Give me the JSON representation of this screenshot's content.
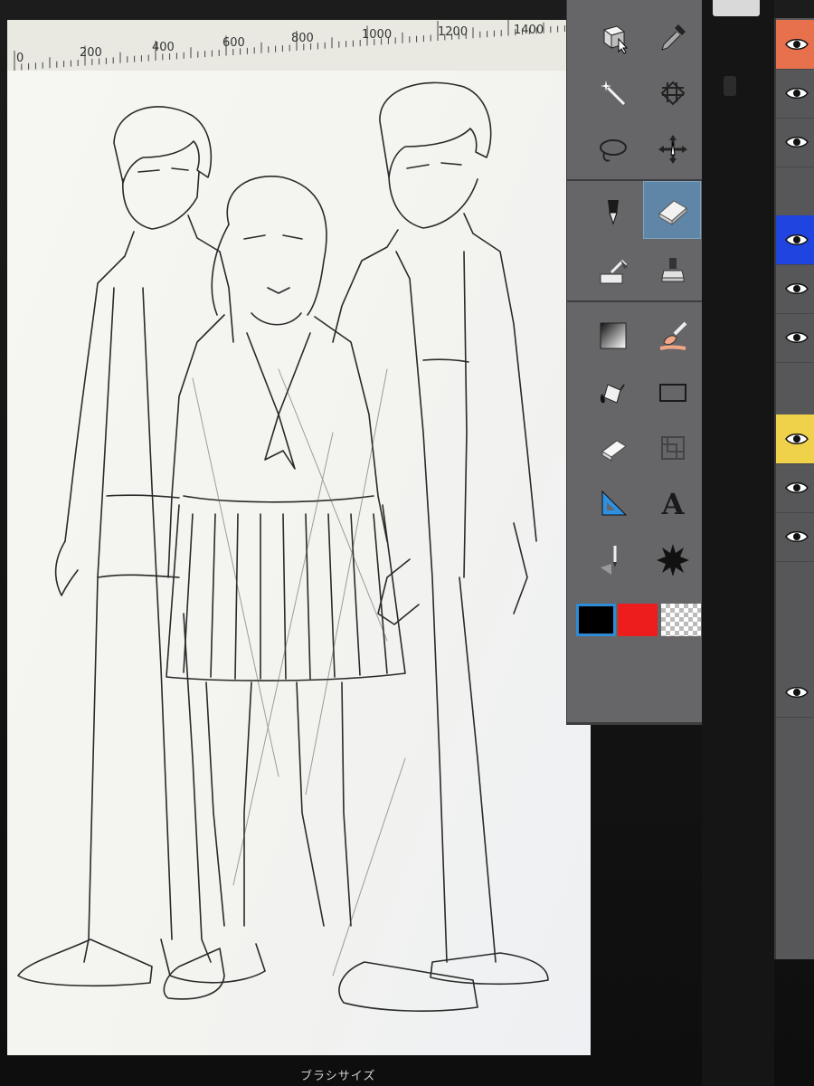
{
  "ruler": {
    "labels": [
      "0",
      "200",
      "400",
      "600",
      "800",
      "1000",
      "1200",
      "1400"
    ]
  },
  "tools": [
    {
      "name": "object-select-icon",
      "group": 0
    },
    {
      "name": "eyedropper-icon",
      "group": 0
    },
    {
      "name": "magic-wand-icon",
      "group": 0
    },
    {
      "name": "selection-pen-icon",
      "group": 0
    },
    {
      "name": "lasso-icon",
      "group": 0
    },
    {
      "name": "move-layer-icon",
      "group": 0
    },
    {
      "name": "pen-icon",
      "group": 1
    },
    {
      "name": "eraser-icon",
      "group": 1,
      "active": true
    },
    {
      "name": "decoration-icon",
      "group": 1
    },
    {
      "name": "stamp-icon",
      "group": 1
    },
    {
      "name": "gradient-icon",
      "group": 2
    },
    {
      "name": "blend-brush-icon",
      "group": 2
    },
    {
      "name": "fill-bucket-icon",
      "group": 2
    },
    {
      "name": "rectangle-icon",
      "group": 2
    },
    {
      "name": "block-eraser-icon",
      "group": 2
    },
    {
      "name": "frame-border-icon",
      "group": 2
    },
    {
      "name": "ruler-triangle-icon",
      "group": 2
    },
    {
      "name": "text-icon",
      "group": 2,
      "label": "A"
    },
    {
      "name": "speech-balloon-pen-icon",
      "group": 2
    },
    {
      "name": "flash-effect-icon",
      "group": 2
    }
  ],
  "colors": {
    "primary": "#000000",
    "secondary": "#ee1d1d",
    "tertiary": "transparent"
  },
  "layers": [
    {
      "color": "#e8714d",
      "visible": true
    },
    {
      "color": "",
      "visible": true
    },
    {
      "color": "",
      "visible": true
    },
    {
      "color": "#1f44e0",
      "visible": true
    },
    {
      "color": "",
      "visible": true
    },
    {
      "color": "",
      "visible": true
    },
    {
      "color": "#f0d24a",
      "visible": true
    },
    {
      "color": "",
      "visible": true
    },
    {
      "color": "",
      "visible": true
    },
    {
      "color": "",
      "visible": true
    }
  ],
  "status": {
    "brush_size_label": "ブラシサイズ"
  }
}
